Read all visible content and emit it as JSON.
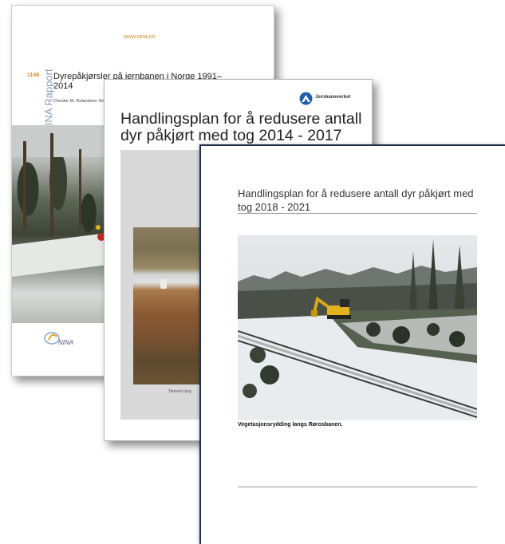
{
  "cover_nina": {
    "url": "www.nina.no",
    "report_number": "1146",
    "series": "NINA Rapport",
    "title": "Dyrepåkjørsler på jernbanen i Norge 1991–2014",
    "authors": "Christer M. Rolandsen Strand",
    "logo_text": "NINA"
  },
  "cover_jbv": {
    "brand": "Jernbaneverket",
    "title": "Handlingsplan for å redusere antall dyr påkjørt med tog 2014 - 2017",
    "caption": "Tamrein lang"
  },
  "cover_2018": {
    "title": "Handlingsplan for å redusere antall dyr påkjørt med tog 2018 - 2021",
    "caption": "Vegetasjonsrydding langs Rørosbanen."
  }
}
